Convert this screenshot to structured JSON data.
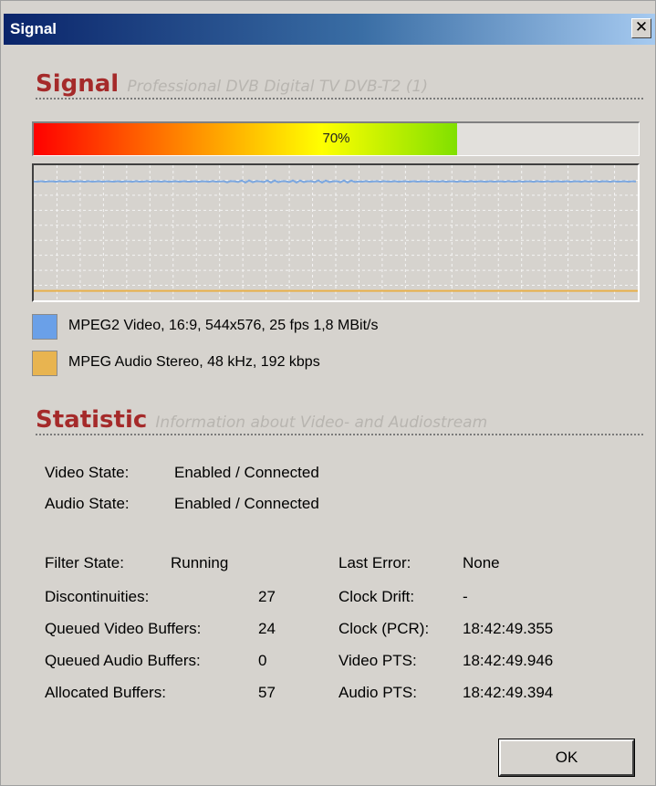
{
  "window": {
    "title": "Signal",
    "close_glyph": "✕"
  },
  "signal_section": {
    "heading": "Signal",
    "subheading": "Professional DVB Digital TV DVB-T2 (1)"
  },
  "signal_strength": {
    "label": "70%",
    "fraction": 0.7
  },
  "graph": {
    "video_line_color": "#7ba7e0",
    "audio_line_color": "#e8b04a",
    "video_level": 0.12,
    "audio_level": 0.93
  },
  "legend": [
    {
      "label": "MPEG2 Video, 16:9, 544x576, 25 fps  1,8 MBit/s",
      "color": "#6aa0e8",
      "icon": "video-swatch"
    },
    {
      "label": "MPEG Audio Stereo, 48 kHz, 192 kbps",
      "color": "#e8b450",
      "icon": "audio-swatch"
    }
  ],
  "statistic_section": {
    "heading": "Statistic",
    "subheading": "Information about Video- and Audiostream"
  },
  "state": {
    "video_label": "Video State:",
    "video_value": "Enabled / Connected",
    "audio_label": "Audio State:",
    "audio_value": "Enabled / Connected"
  },
  "stats_left": [
    {
      "label": "Filter State:",
      "value": "Running"
    },
    {
      "label": "Discontinuities:",
      "value": "27"
    },
    {
      "label": "Queued Video Buffers:",
      "value": "24"
    },
    {
      "label": "Queued Audio Buffers:",
      "value": "0"
    },
    {
      "label": "Allocated Buffers:",
      "value": "57"
    }
  ],
  "stats_right": [
    {
      "label": "Last Error:",
      "value": "None"
    },
    {
      "label": "Clock Drift:",
      "value": "-"
    },
    {
      "label": "Clock (PCR):",
      "value": "18:42:49.355"
    },
    {
      "label": "Video PTS:",
      "value": "18:42:49.946"
    },
    {
      "label": "Audio PTS:",
      "value": "18:42:49.394"
    }
  ],
  "buttons": {
    "ok_label": "OK"
  },
  "colors": {
    "title_bar": "#0a246a",
    "heading_red": "#a52a2a",
    "dialog_bg": "#d6d3ce"
  }
}
